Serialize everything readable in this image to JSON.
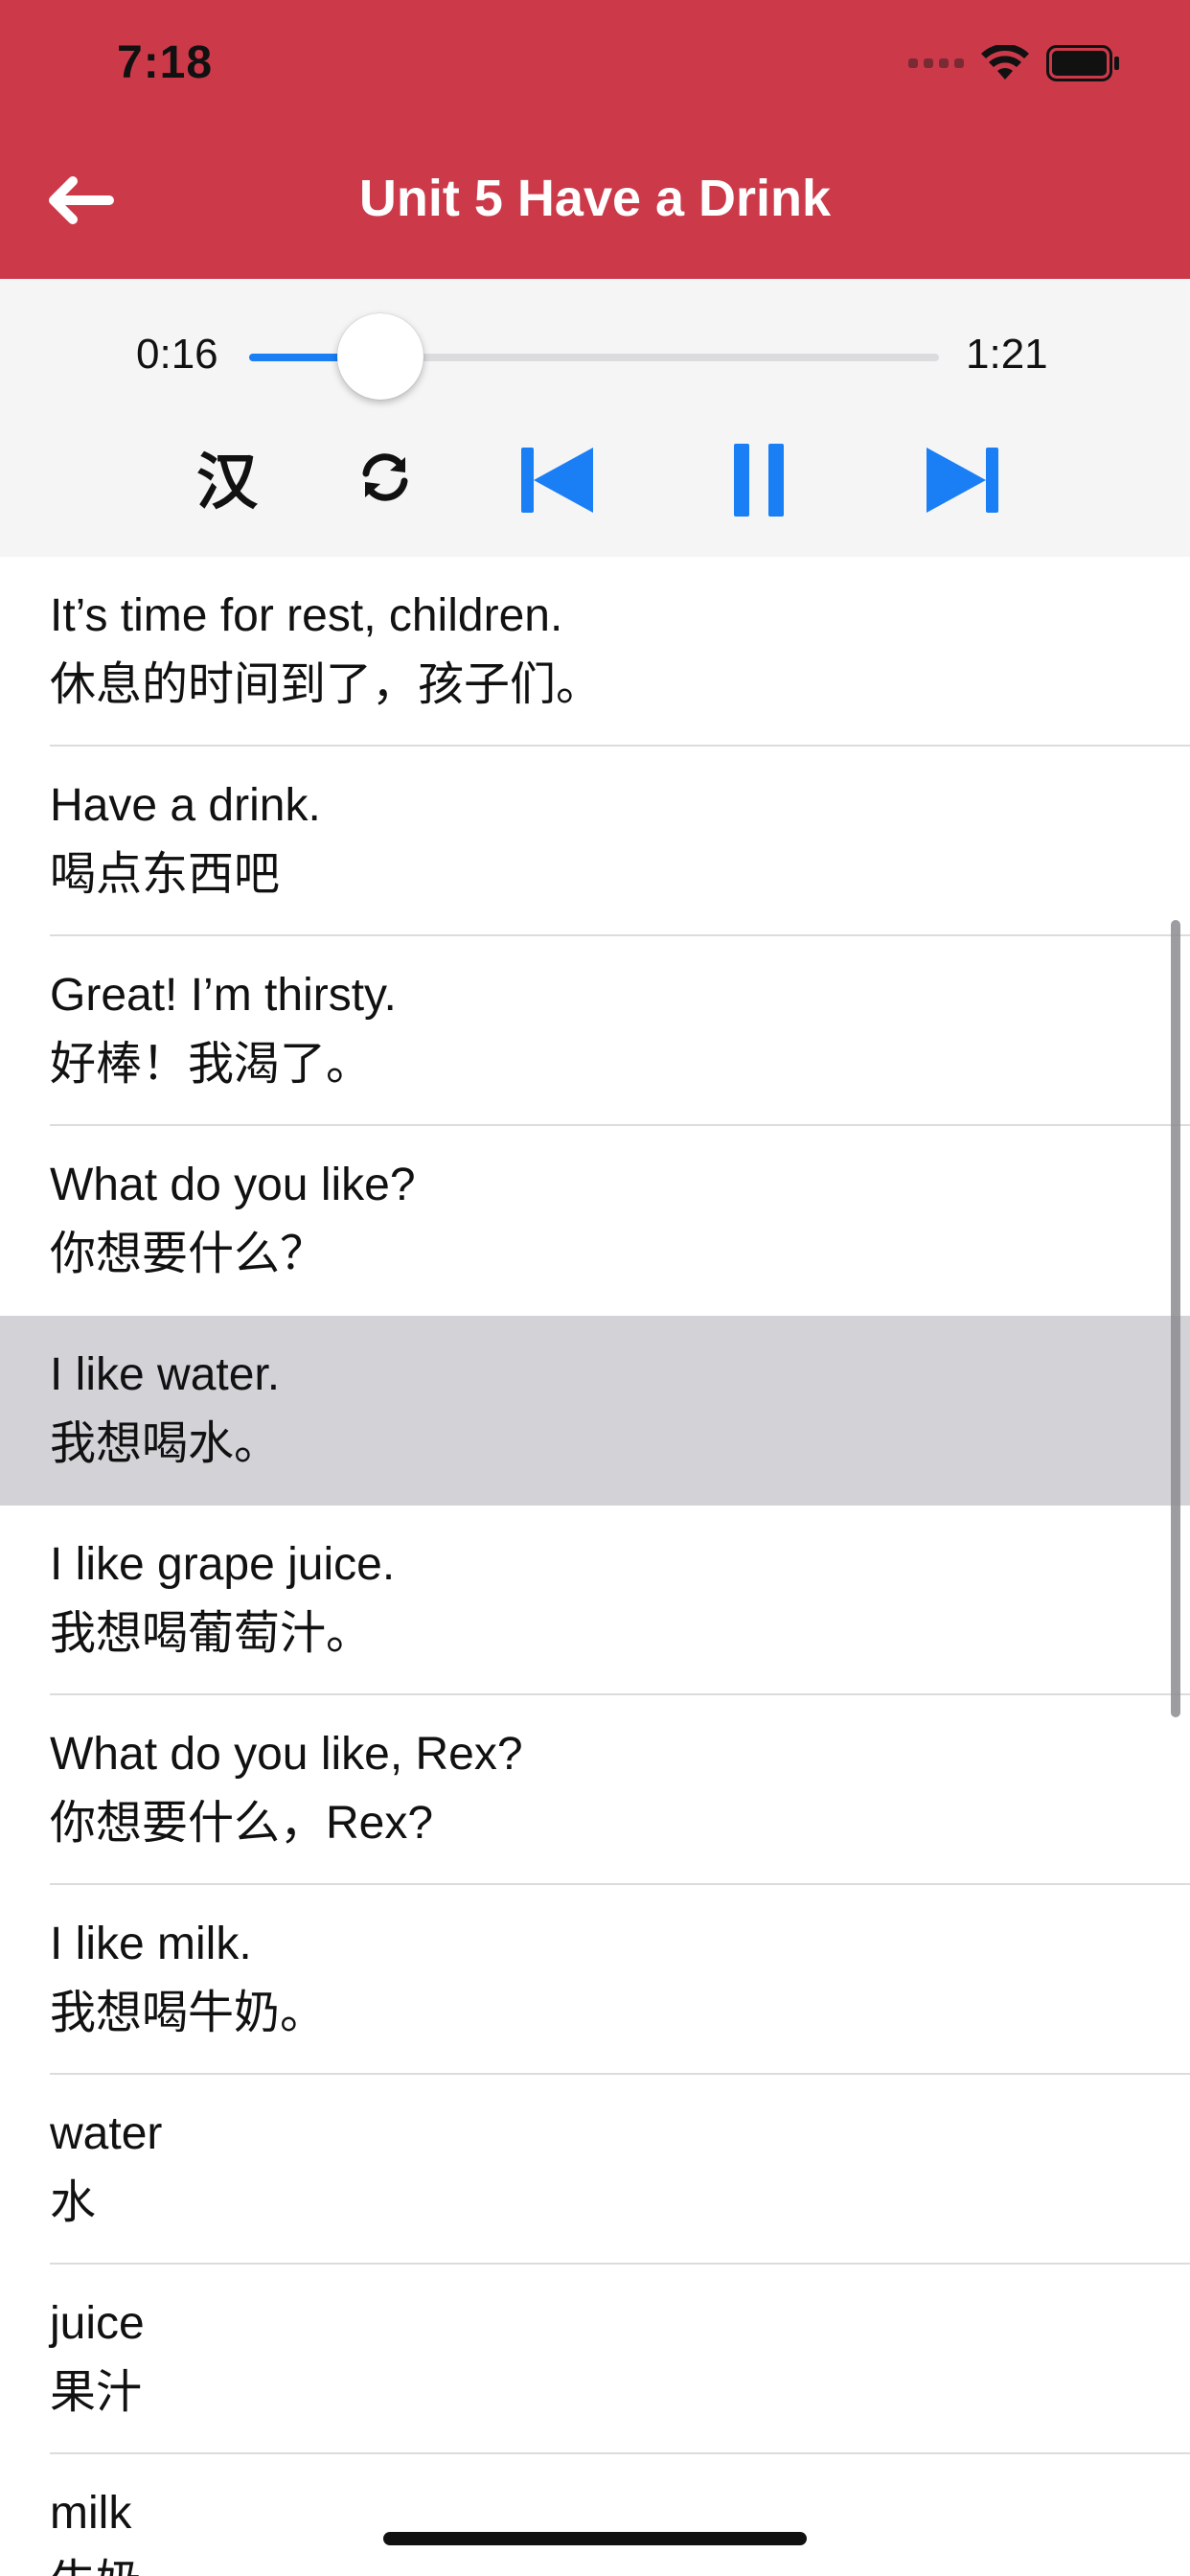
{
  "status_bar": {
    "time": "7:18",
    "icons": [
      "signal-dots-icon",
      "wifi-icon",
      "battery-icon"
    ]
  },
  "nav": {
    "back_icon": "arrow-left-icon",
    "title": "Unit 5 Have a Drink"
  },
  "player": {
    "current_time": "0:16",
    "total_time": "1:21",
    "progress": 0.19,
    "controls": {
      "translate_label": "汉",
      "repeat_icon": "repeat-icon",
      "previous_icon": "skip-previous-icon",
      "pause_icon": "pause-icon",
      "next_icon": "skip-next-icon"
    }
  },
  "colors": {
    "nav_bar": "#cc3a4a",
    "accent_blue": "#1a7ef5",
    "selected_row": "#d2d2d7"
  },
  "list": {
    "selected_index": 4,
    "items": [
      {
        "en": "It’s time for rest, children.",
        "zh": "休息的时间到了，孩子们。"
      },
      {
        "en": "Have a drink.",
        "zh": "喝点东西吧"
      },
      {
        "en": "Great! I’m thirsty.",
        "zh": "好棒！我渴了。"
      },
      {
        "en": "What do you like?",
        "zh": "你想要什么？"
      },
      {
        "en": "I like water.",
        "zh": "我想喝水。"
      },
      {
        "en": "I like grape juice.",
        "zh": "我想喝葡萄汁。"
      },
      {
        "en": "What do you like, Rex?",
        "zh": "你想要什么，Rex?"
      },
      {
        "en": "I like milk.",
        "zh": "我想喝牛奶。"
      },
      {
        "en": "water",
        "zh": "水"
      },
      {
        "en": "juice",
        "zh": "果汁"
      },
      {
        "en": "milk",
        "zh": "牛奶"
      }
    ]
  }
}
